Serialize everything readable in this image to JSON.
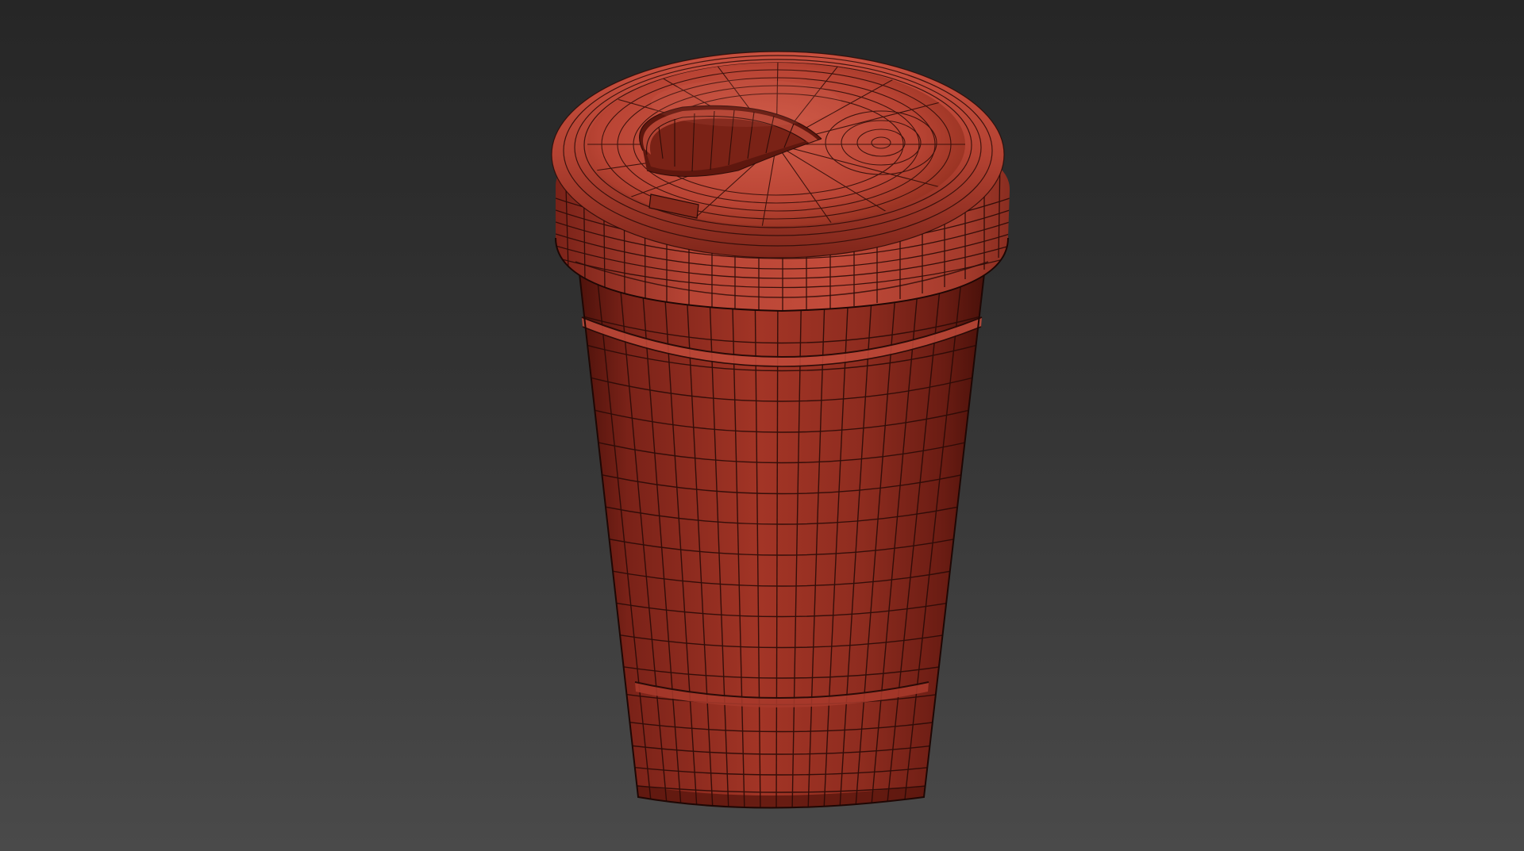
{
  "viewport": {
    "background_top": "#262626",
    "background_bottom": "#4a4a4a"
  },
  "model": {
    "name_icon": "cup-3d-model",
    "render_mode": "shaded-wireframe",
    "surface_color": "#a8382a",
    "shadow_color": "#6b1a12",
    "highlight_color": "#c5503e",
    "wire_color": "#2a0b07"
  }
}
